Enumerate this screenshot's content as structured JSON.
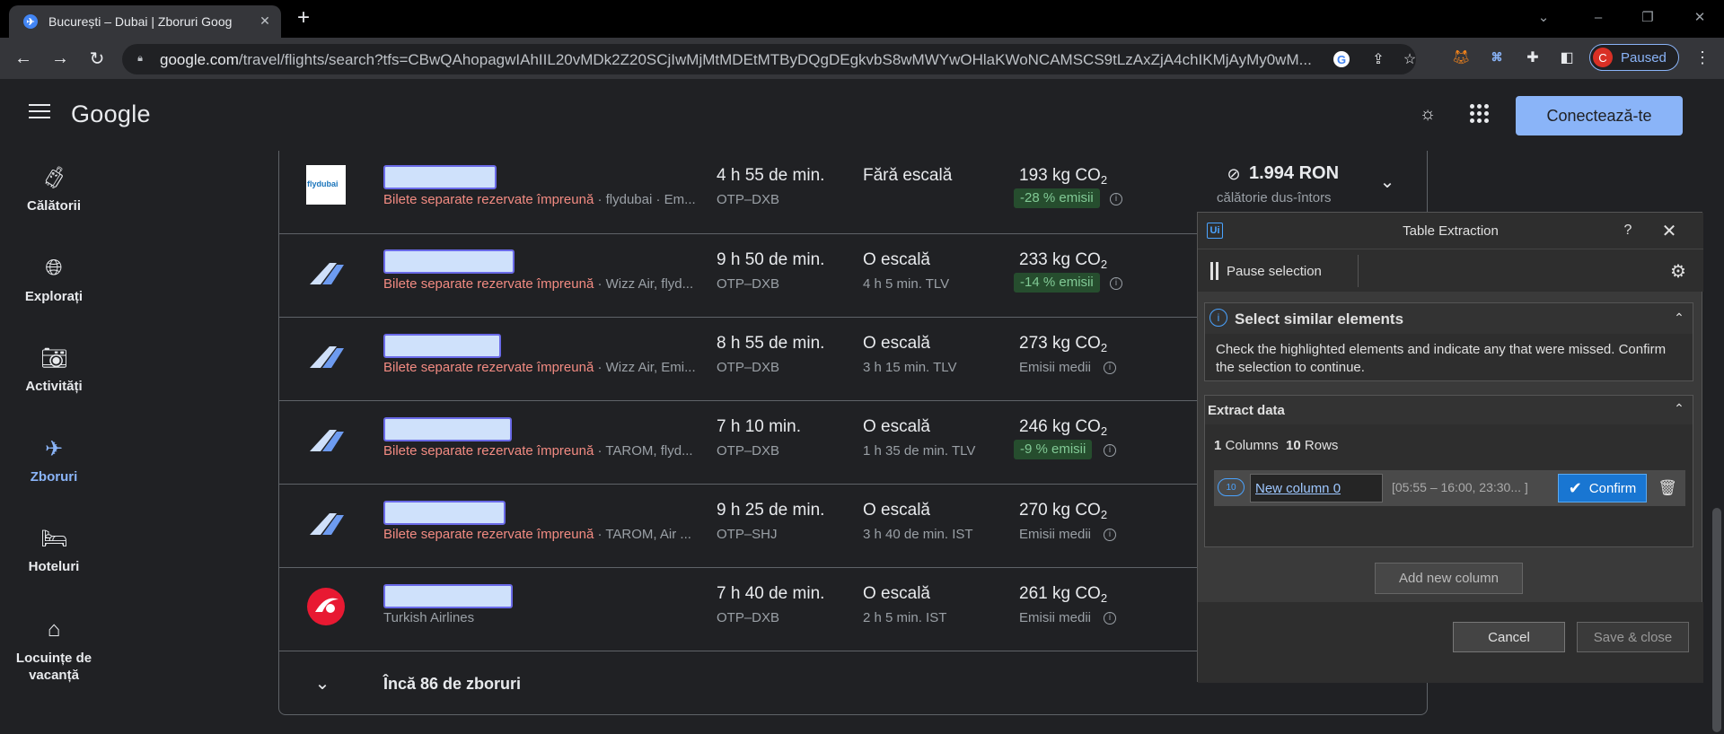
{
  "browser": {
    "tab_title": "București – Dubai | Zboruri Goog",
    "url_host": "google.com",
    "url_path": "/travel/flights/search?tfs=CBwQAhopagwIAhIIL20vMDk2Z20SCjIwMjMtMDEtMTByDQgDEgkvbS8wMWYwOHlaKWoNCAMSCS9tLzAxZjA4chIKMjAyMy0wM...",
    "profile_initial": "C",
    "profile_label": "Paused"
  },
  "header": {
    "logo": "Google",
    "sign_in": "Conectează-te"
  },
  "nav": [
    {
      "label": "Călătorii",
      "icon": "luggage-icon"
    },
    {
      "label": "Explorați",
      "icon": "explore-icon"
    },
    {
      "label": "Activități",
      "icon": "camera-icon"
    },
    {
      "label": "Zboruri",
      "icon": "plane-icon"
    },
    {
      "label": "Hoteluri",
      "icon": "bed-icon"
    },
    {
      "label": "Locuințe de vacanță",
      "icon": "home-icon"
    }
  ],
  "flights": [
    {
      "airline_logo": "flydubai",
      "separate": "Bilete separate rezervate împreună",
      "carriers": " · flydubai · Em...",
      "duration": "4 h 55 de min.",
      "route": "OTP–DXB",
      "stops": "Fără escală",
      "stop_detail": "",
      "co2": "193 kg CO",
      "emissions": "-28 % emisii",
      "emissions_type": "badge",
      "price": "1.994 RON",
      "price_note": "călătorie dus-întors"
    },
    {
      "airline_logo": "wizz-multi",
      "separate": "Bilete separate rezervate împreună",
      "carriers": " · Wizz Air, flyd...",
      "duration": "9 h 50 de min.",
      "route": "OTP–DXB",
      "stops": "O escală",
      "stop_detail": "4 h 5 min. TLV",
      "co2": "233 kg CO",
      "emissions": "-14 % emisii",
      "emissions_type": "badge"
    },
    {
      "airline_logo": "wizz-multi",
      "separate": "Bilete separate rezervate împreună",
      "carriers": " · Wizz Air, Emi...",
      "duration": "8 h 55 de min.",
      "route": "OTP–DXB",
      "stops": "O escală",
      "stop_detail": "3 h 15 min. TLV",
      "co2": "273 kg CO",
      "emissions": "Emisii medii",
      "emissions_type": "avg"
    },
    {
      "airline_logo": "tarom-multi",
      "separate": "Bilete separate rezervate împreună",
      "carriers": " · TAROM, flyd...",
      "duration": "7 h 10 min.",
      "route": "OTP–DXB",
      "stops": "O escală",
      "stop_detail": "1 h 35 de min. TLV",
      "co2": "246 kg CO",
      "emissions": "-9 % emisii",
      "emissions_type": "badge"
    },
    {
      "airline_logo": "tarom-multi",
      "separate": "Bilete separate rezervate împreună",
      "carriers": " · TAROM, Air ...",
      "duration": "9 h 25 de min.",
      "route": "OTP–SHJ",
      "stops": "O escală",
      "stop_detail": "3 h 40 de min. IST",
      "co2": "270 kg CO",
      "emissions": "Emisii medii",
      "emissions_type": "avg"
    },
    {
      "airline_logo": "turkish",
      "separate": "",
      "carriers": "Turkish Airlines",
      "duration": "7 h 40 de min.",
      "route": "OTP–DXB",
      "stops": "O escală",
      "stop_detail": "2 h 5 min. IST",
      "co2": "261 kg CO",
      "emissions": "Emisii medii",
      "emissions_type": "avg"
    }
  ],
  "co2_subscript": "2",
  "more_flights": "Încă 86 de zboruri",
  "panel": {
    "logo": "Ui",
    "title": "Table Extraction",
    "help": "?",
    "pause": "Pause selection",
    "similar_title": "Select similar elements",
    "similar_text": "Check the highlighted elements and indicate any that were missed. Confirm the selection to continue.",
    "extract_title": "Extract data",
    "columns_count": "1",
    "columns_label": "Columns",
    "rows_count": "10",
    "rows_label": "Rows",
    "column_name": "New column 0",
    "column_preview": "[05:55 – 16:00, 23:30... ]",
    "confirm": "Confirm",
    "add_column": "Add new column",
    "cancel": "Cancel",
    "save_close": "Save & close"
  }
}
